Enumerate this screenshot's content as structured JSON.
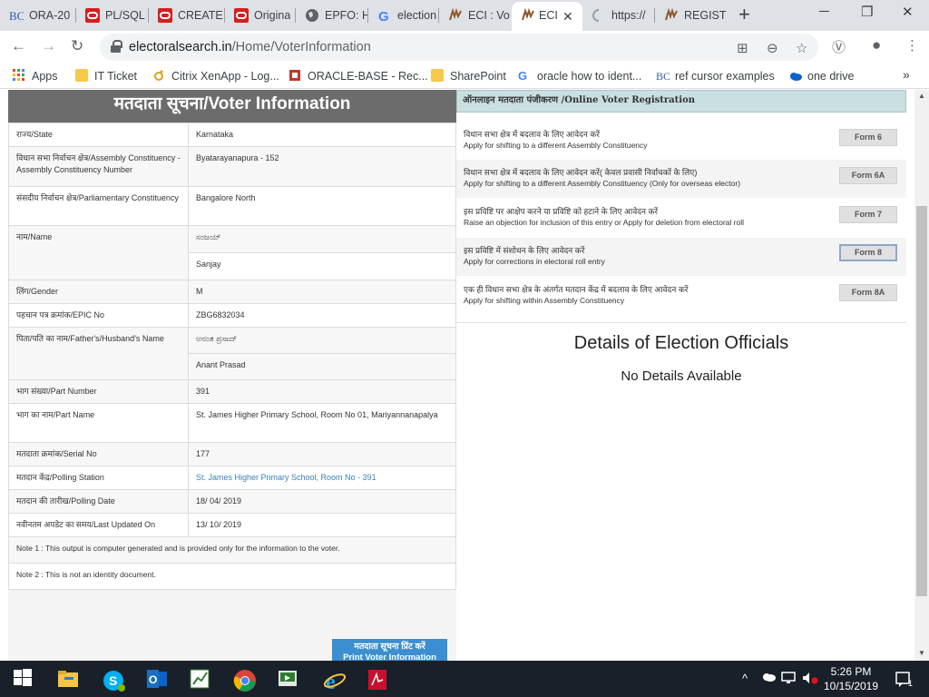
{
  "browser": {
    "tabs": [
      {
        "title": "ORA-20",
        "icon": "bc-icon"
      },
      {
        "title": "PL/SQL",
        "icon": "oracle-icon"
      },
      {
        "title": "CREATE",
        "icon": "oracle-icon"
      },
      {
        "title": "Origina",
        "icon": "oracle-icon"
      },
      {
        "title": "EPFO: H",
        "icon": "globe-icon"
      },
      {
        "title": "election",
        "icon": "google-icon"
      },
      {
        "title": "ECI : Vo",
        "icon": "eci-icon"
      },
      {
        "title": "ECI",
        "icon": "eci-icon",
        "active": true
      },
      {
        "title": "https://",
        "icon": "loading-icon"
      },
      {
        "title": "REGIST",
        "icon": "eci-icon"
      }
    ],
    "close_tab_glyph": "✕",
    "new_tab_glyph": "+",
    "window_controls": {
      "minimize": "─",
      "restore": "❐",
      "close": "✕"
    },
    "nav": {
      "back": "←",
      "forward": "→",
      "reload": "↻"
    },
    "address": {
      "host": "electoralsearch.in",
      "path": "/Home/VoterInformation"
    },
    "omnibox_icons": {
      "translate": "⊞",
      "zoom": "⊖",
      "bookmark": "☆",
      "extension": "Ⓥ",
      "account": "●",
      "menu": "⋮"
    },
    "bookmarks": [
      {
        "label": "Apps",
        "icon": "apps-grid-icon"
      },
      {
        "label": "IT Ticket",
        "icon": "folder-icon"
      },
      {
        "label": "Citrix XenApp - Log...",
        "icon": "citrix-icon"
      },
      {
        "label": "ORACLE-BASE - Rec...",
        "icon": "oracle-base-icon"
      },
      {
        "label": "SharePoint",
        "icon": "folder-icon"
      },
      {
        "label": "oracle how to ident...",
        "icon": "google-icon"
      },
      {
        "label": "ref cursor examples",
        "icon": "bc-icon"
      },
      {
        "label": "one drive",
        "icon": "cloud-icon"
      }
    ],
    "bookmarks_overflow": "»"
  },
  "voter": {
    "heading": "मतदाता सूचना/Voter Information",
    "rows": [
      {
        "label": "राज्य/State",
        "value": "Karnataka"
      },
      {
        "label": "विधान सभा निर्वाचन क्षेत्र/Assembly Constituency - Assembly Constituency Number",
        "value": "Byatarayanapura - 152"
      },
      {
        "label": "संसदीय निर्वाचन क्षेत्र/Parliamentary Constituency",
        "value": "Bangalore North"
      },
      {
        "label": "नाम/Name",
        "value": "ಸಂಜಯ್",
        "value2": "Sanjay"
      },
      {
        "label": "लिंग/Gender",
        "value": "M"
      },
      {
        "label": "पहचान पत्र क्रमांक/EPIC No",
        "value": "ZBG6832034"
      },
      {
        "label": "पिता/पति का नाम/Father's/Husband's Name",
        "value": "ಅನಂತ ಪ್ರಸಾದ್",
        "value2": "Anant Prasad"
      },
      {
        "label": "भाग संख्या/Part Number",
        "value": "391"
      },
      {
        "label": "भाग का नाम/Part Name",
        "value": "St. James Higher Primary School, Room No 01, Mariyannanapalya"
      },
      {
        "label": "मतदाता क्रमांक/Serial No",
        "value": "177"
      },
      {
        "label": "मतदान केंद्र/Polling Station",
        "value": "St. James Higher Primary School, Room No - 391"
      },
      {
        "label": "मतदान की तारीख/Polling Date",
        "value": "18/ 04/ 2019"
      },
      {
        "label": "नवीनतम अपडेट का समय/Last Updated On",
        "value": "13/ 10/ 2019"
      }
    ],
    "note1": "Note 1 : This output is computer generated and is provided only for the information to the voter.",
    "note2": "Note 2 : This is not an identity document.",
    "print_button": {
      "hindi": "मतदाता सूचना प्रिंट करें",
      "english": "Print Voter Information"
    }
  },
  "registration": {
    "heading": "ऑनलाइन मतदाता पंजीकरण /Online Voter Registration",
    "forms": [
      {
        "hindi": "विधान सभा क्षेत्र में बदलाव के लिए आवेदन करें",
        "english": "Apply for shifting to a different Assembly Constituency",
        "button": "Form 6"
      },
      {
        "hindi": "विधान सभा क्षेत्र में बदलाव के लिए आवेदन करें( केवल प्रवासी निर्वाचकों के लिए)",
        "english": "Apply for shifting to a different Assembly Constituency (Only for overseas elector)",
        "button": "Form 6A"
      },
      {
        "hindi": "इस प्रविष्टि पर आक्षेप करने या प्रविष्टि को हटाने के लिए आवेदन करें",
        "english": "Raise an objection for inclusion of this entry or Apply for deletion from electoral roll",
        "button": "Form 7"
      },
      {
        "hindi": "इस प्रविष्टि में संशोधन के लिए आवेदन करें",
        "english": "Apply for corrections in electoral roll entry",
        "button": "Form 8"
      },
      {
        "hindi": "एक ही विधान सभा क्षेत्र के अंतर्गत मतदान केंद्र में बदलाव के लिए आवेदन करें",
        "english": "Apply for shifting within Assembly Constituency",
        "button": "Form 8A"
      }
    ]
  },
  "officials": {
    "title": "Details of Election Officials",
    "status": "No Details Available"
  },
  "taskbar": {
    "time": "5:26 PM",
    "date": "10/15/2019",
    "notification_count": "1"
  },
  "colors": {
    "tab_strip": "#dee1e6",
    "voter_header": "#6c6c6c",
    "registration_header": "#c9dfe0",
    "link": "#3a7fb5",
    "print_button": "#3b8ed0",
    "taskbar": "#1a2029"
  }
}
